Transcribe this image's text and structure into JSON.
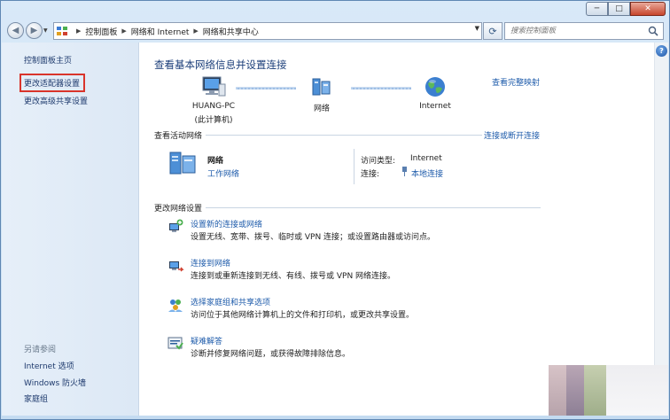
{
  "window": {
    "minimize_glyph": "─",
    "maximize_glyph": "□",
    "close_glyph": "✕"
  },
  "address": {
    "crumbs": [
      "控制面板",
      "网络和 Internet",
      "网络和共享中心"
    ],
    "search_placeholder": "搜索控制面板"
  },
  "sidebar": {
    "items": [
      {
        "label": "控制面板主页"
      },
      {
        "label": "更改适配器设置"
      },
      {
        "label": "更改高级共享设置"
      }
    ],
    "see_also_title": "另请参阅",
    "see_also": [
      {
        "label": "Internet 选项"
      },
      {
        "label": "Windows 防火墙"
      },
      {
        "label": "家庭组"
      }
    ]
  },
  "main": {
    "title": "查看基本网络信息并设置连接",
    "full_map_link": "查看完整映射",
    "map": {
      "computer_name": "HUANG-PC",
      "computer_sub": "(此计算机)",
      "network": "网络",
      "internet": "Internet"
    },
    "active_networks": {
      "header": "查看活动网络",
      "connect_link": "连接或断开连接",
      "network_name": "网络",
      "network_type": "工作网络",
      "access_type_label": "访问类型:",
      "access_type_value": "Internet",
      "connections_label": "连接:",
      "connections_value": "本地连接"
    },
    "change_settings": {
      "header": "更改网络设置",
      "tasks": [
        {
          "title": "设置新的连接或网络",
          "desc": "设置无线、宽带、拨号、临时或 VPN 连接；或设置路由器或访问点。",
          "icon": "network-setup-icon"
        },
        {
          "title": "连接到网络",
          "desc": "连接到或重新连接到无线、有线、拨号或 VPN 网络连接。",
          "icon": "connect-network-icon"
        },
        {
          "title": "选择家庭组和共享选项",
          "desc": "访问位于其他网络计算机上的文件和打印机，或更改共享设置。",
          "icon": "homegroup-icon"
        },
        {
          "title": "疑难解答",
          "desc": "诊断并修复网络问题，或获得故障排除信息。",
          "icon": "troubleshoot-icon"
        }
      ]
    }
  },
  "colors": {
    "link": "#1f5cab",
    "title": "#1c3f7a",
    "highlight_border": "#d9342b"
  }
}
